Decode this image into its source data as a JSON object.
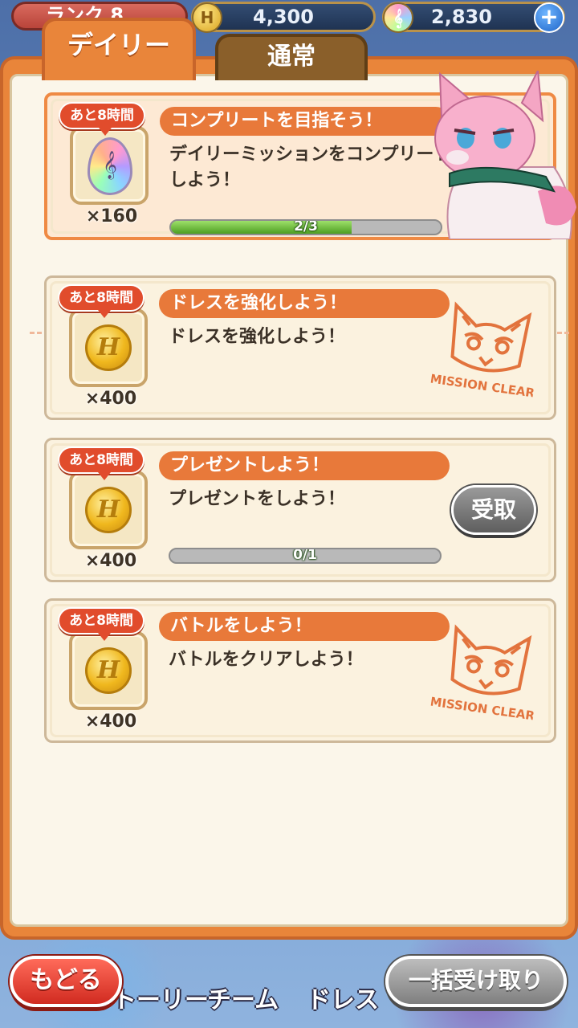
{
  "topbar": {
    "rank_label": "ランク 8",
    "coins": "4,300",
    "gems": "2,830",
    "plus": "+"
  },
  "tabs": [
    {
      "label": "デイリー",
      "active": true
    },
    {
      "label": "通常",
      "active": false
    }
  ],
  "missions": [
    {
      "time_left": "あと8時間",
      "title": "コンプリートを目指そう！",
      "description": "デイリーミッションをコンプリートしよう！",
      "reward_icon": "gem-icon",
      "reward_qty": "×160",
      "progress_text": "2/3",
      "progress": 0.67,
      "status": "in-progress"
    },
    {
      "time_left": "あと8時間",
      "title": "ドレスを強化しよう！",
      "description": "ドレスを強化しよう！",
      "reward_icon": "coin-icon",
      "reward_qty": "×400",
      "status": "cleared",
      "stamp_text": "MISSION CLEAR"
    },
    {
      "time_left": "あと8時間",
      "title": "プレゼントしよう！",
      "description": "プレゼントをしよう！",
      "reward_icon": "coin-icon",
      "reward_qty": "×400",
      "progress_text": "0/1",
      "progress": 0,
      "claim_label": "受取",
      "status": "in-progress"
    },
    {
      "time_left": "あと8時間",
      "title": "バトルをしよう！",
      "description": "バトルをクリアしよう！",
      "reward_icon": "coin-icon",
      "reward_qty": "×400",
      "status": "cleared",
      "stamp_text": "MISSION CLEAR"
    }
  ],
  "bottom_nav": {
    "back_label": "もどる",
    "items": [
      "トーリー",
      "チーム",
      "ドレス"
    ],
    "collect_all_label": "一括受け取り"
  },
  "colors": {
    "panel_orange": "#e9853a",
    "title_orange": "#e8793a",
    "badge_red": "#e14c2c",
    "stamp_orange": "#e0662c",
    "progress_green": "#4e9e22"
  }
}
